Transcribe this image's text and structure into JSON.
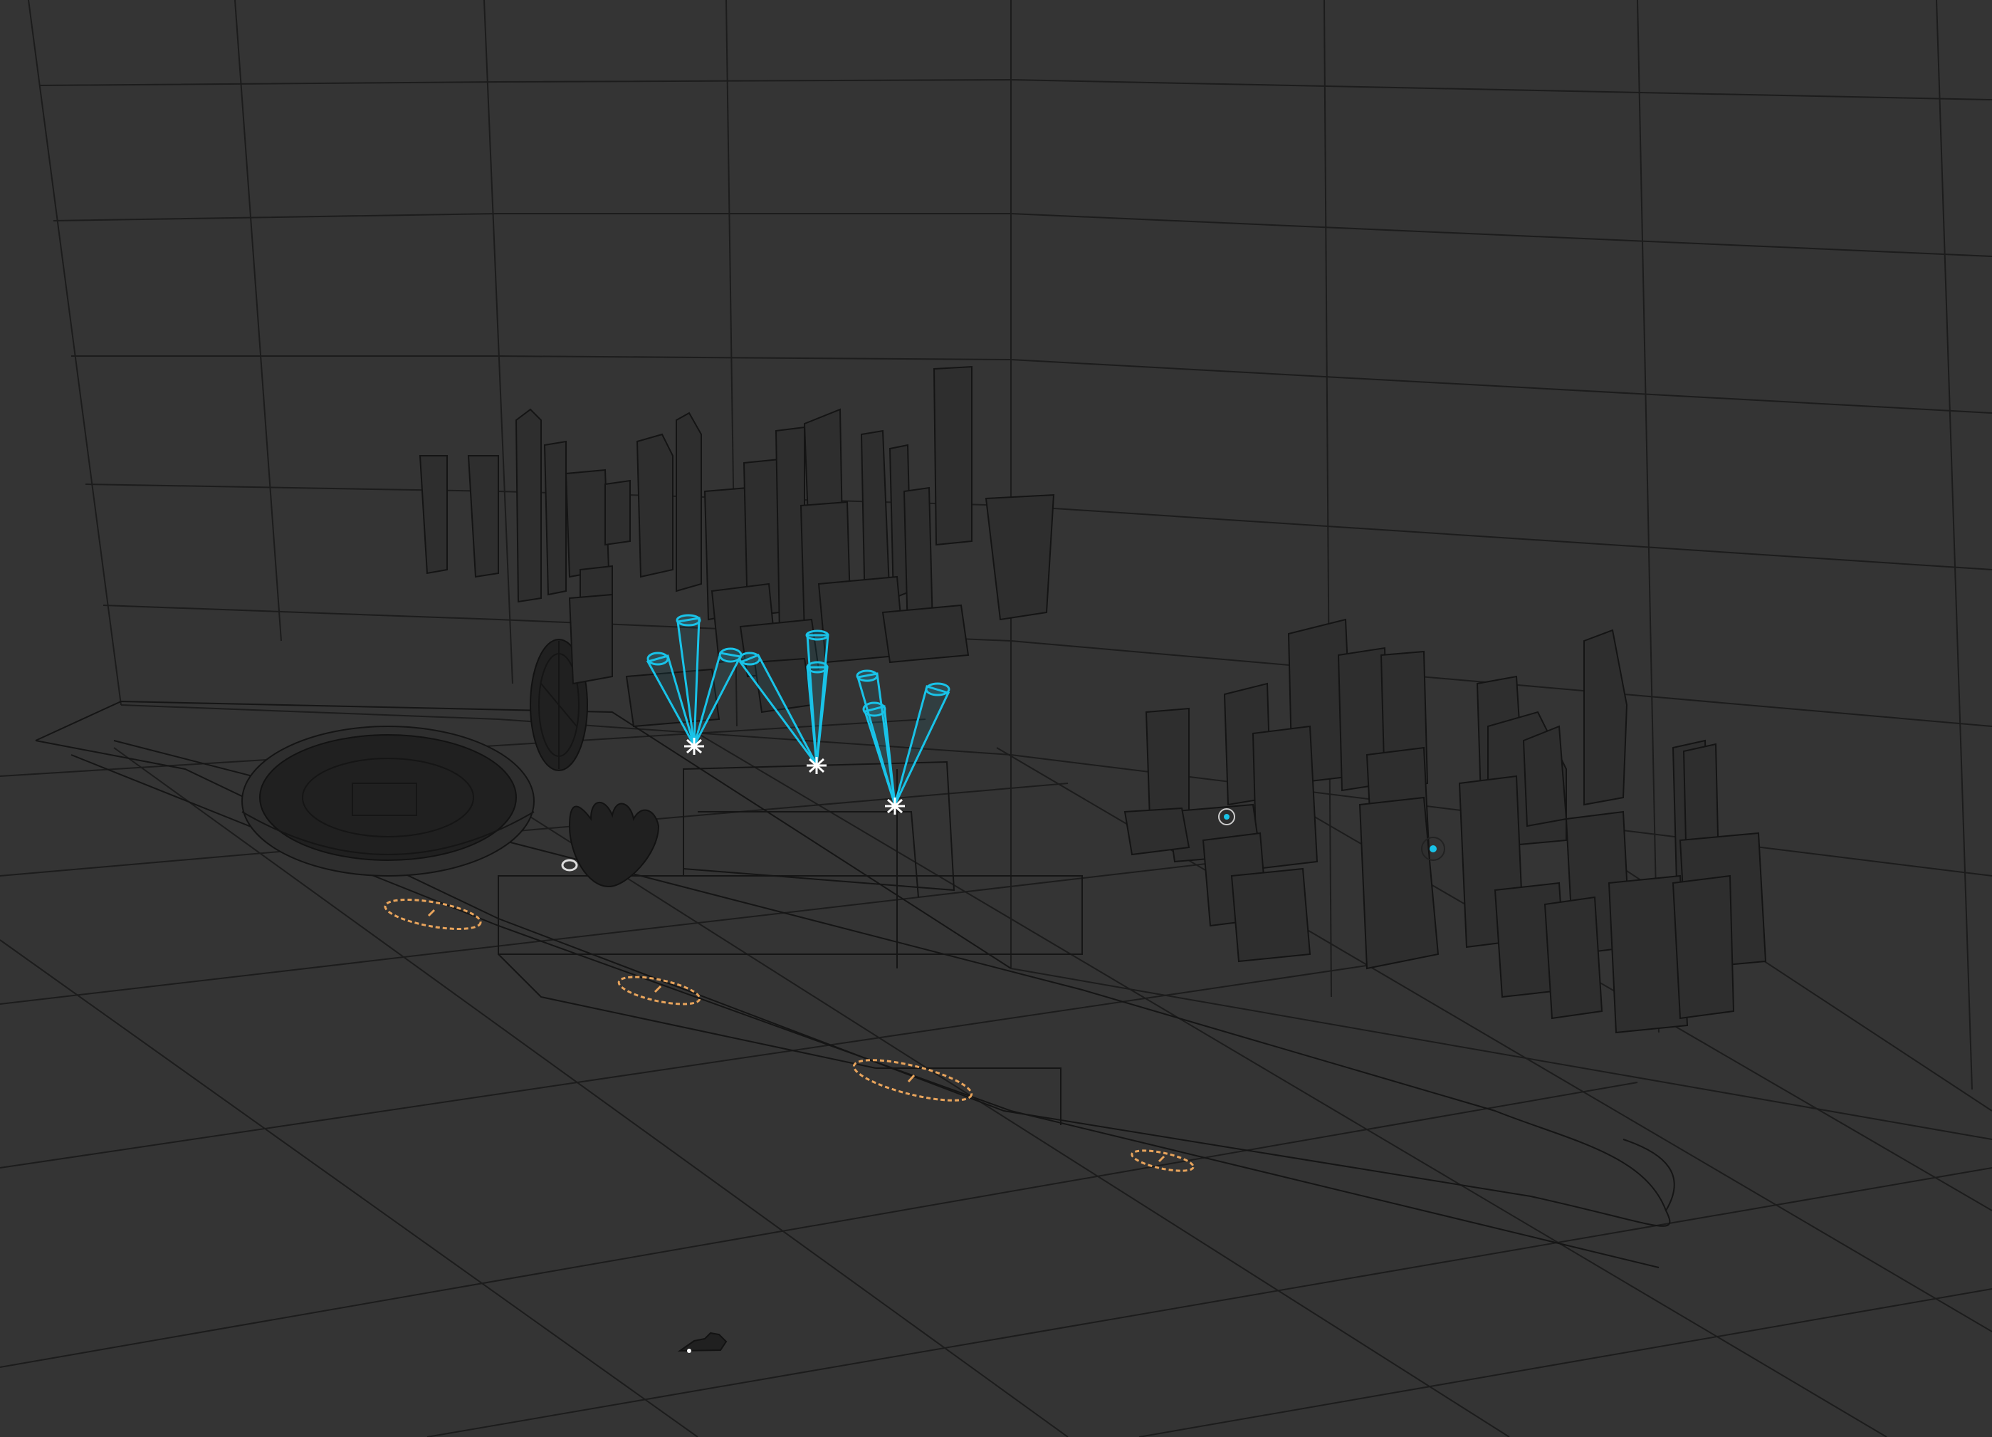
{
  "viewport": {
    "background": "#343434",
    "grid_color": "#1c1c1c",
    "wire_color": "#151515"
  },
  "scene": {
    "spotlight_color": "#19c3e8",
    "camera_target_color": "#e8a45c",
    "emitter_color": "#ffffff",
    "spotlights": 9,
    "camera_targets": 4,
    "point_lights": 2
  }
}
